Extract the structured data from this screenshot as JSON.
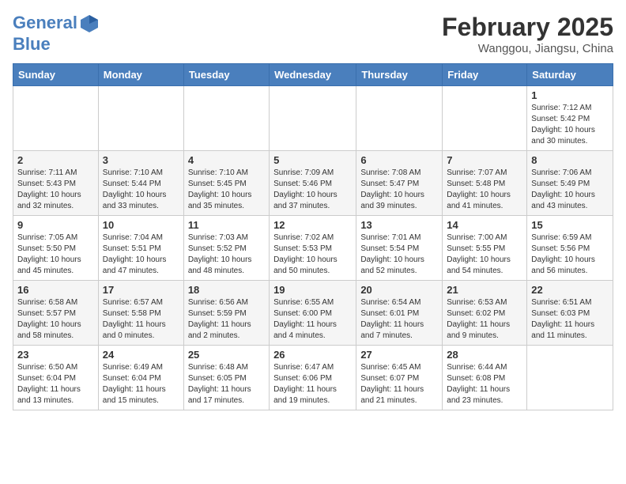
{
  "header": {
    "logo_line1": "General",
    "logo_line2": "Blue",
    "month_title": "February 2025",
    "location": "Wanggou, Jiangsu, China"
  },
  "days_of_week": [
    "Sunday",
    "Monday",
    "Tuesday",
    "Wednesday",
    "Thursday",
    "Friday",
    "Saturday"
  ],
  "weeks": [
    [
      {
        "day": "",
        "info": ""
      },
      {
        "day": "",
        "info": ""
      },
      {
        "day": "",
        "info": ""
      },
      {
        "day": "",
        "info": ""
      },
      {
        "day": "",
        "info": ""
      },
      {
        "day": "",
        "info": ""
      },
      {
        "day": "1",
        "info": "Sunrise: 7:12 AM\nSunset: 5:42 PM\nDaylight: 10 hours and 30 minutes."
      }
    ],
    [
      {
        "day": "2",
        "info": "Sunrise: 7:11 AM\nSunset: 5:43 PM\nDaylight: 10 hours and 32 minutes."
      },
      {
        "day": "3",
        "info": "Sunrise: 7:10 AM\nSunset: 5:44 PM\nDaylight: 10 hours and 33 minutes."
      },
      {
        "day": "4",
        "info": "Sunrise: 7:10 AM\nSunset: 5:45 PM\nDaylight: 10 hours and 35 minutes."
      },
      {
        "day": "5",
        "info": "Sunrise: 7:09 AM\nSunset: 5:46 PM\nDaylight: 10 hours and 37 minutes."
      },
      {
        "day": "6",
        "info": "Sunrise: 7:08 AM\nSunset: 5:47 PM\nDaylight: 10 hours and 39 minutes."
      },
      {
        "day": "7",
        "info": "Sunrise: 7:07 AM\nSunset: 5:48 PM\nDaylight: 10 hours and 41 minutes."
      },
      {
        "day": "8",
        "info": "Sunrise: 7:06 AM\nSunset: 5:49 PM\nDaylight: 10 hours and 43 minutes."
      }
    ],
    [
      {
        "day": "9",
        "info": "Sunrise: 7:05 AM\nSunset: 5:50 PM\nDaylight: 10 hours and 45 minutes."
      },
      {
        "day": "10",
        "info": "Sunrise: 7:04 AM\nSunset: 5:51 PM\nDaylight: 10 hours and 47 minutes."
      },
      {
        "day": "11",
        "info": "Sunrise: 7:03 AM\nSunset: 5:52 PM\nDaylight: 10 hours and 48 minutes."
      },
      {
        "day": "12",
        "info": "Sunrise: 7:02 AM\nSunset: 5:53 PM\nDaylight: 10 hours and 50 minutes."
      },
      {
        "day": "13",
        "info": "Sunrise: 7:01 AM\nSunset: 5:54 PM\nDaylight: 10 hours and 52 minutes."
      },
      {
        "day": "14",
        "info": "Sunrise: 7:00 AM\nSunset: 5:55 PM\nDaylight: 10 hours and 54 minutes."
      },
      {
        "day": "15",
        "info": "Sunrise: 6:59 AM\nSunset: 5:56 PM\nDaylight: 10 hours and 56 minutes."
      }
    ],
    [
      {
        "day": "16",
        "info": "Sunrise: 6:58 AM\nSunset: 5:57 PM\nDaylight: 10 hours and 58 minutes."
      },
      {
        "day": "17",
        "info": "Sunrise: 6:57 AM\nSunset: 5:58 PM\nDaylight: 11 hours and 0 minutes."
      },
      {
        "day": "18",
        "info": "Sunrise: 6:56 AM\nSunset: 5:59 PM\nDaylight: 11 hours and 2 minutes."
      },
      {
        "day": "19",
        "info": "Sunrise: 6:55 AM\nSunset: 6:00 PM\nDaylight: 11 hours and 4 minutes."
      },
      {
        "day": "20",
        "info": "Sunrise: 6:54 AM\nSunset: 6:01 PM\nDaylight: 11 hours and 7 minutes."
      },
      {
        "day": "21",
        "info": "Sunrise: 6:53 AM\nSunset: 6:02 PM\nDaylight: 11 hours and 9 minutes."
      },
      {
        "day": "22",
        "info": "Sunrise: 6:51 AM\nSunset: 6:03 PM\nDaylight: 11 hours and 11 minutes."
      }
    ],
    [
      {
        "day": "23",
        "info": "Sunrise: 6:50 AM\nSunset: 6:04 PM\nDaylight: 11 hours and 13 minutes."
      },
      {
        "day": "24",
        "info": "Sunrise: 6:49 AM\nSunset: 6:04 PM\nDaylight: 11 hours and 15 minutes."
      },
      {
        "day": "25",
        "info": "Sunrise: 6:48 AM\nSunset: 6:05 PM\nDaylight: 11 hours and 17 minutes."
      },
      {
        "day": "26",
        "info": "Sunrise: 6:47 AM\nSunset: 6:06 PM\nDaylight: 11 hours and 19 minutes."
      },
      {
        "day": "27",
        "info": "Sunrise: 6:45 AM\nSunset: 6:07 PM\nDaylight: 11 hours and 21 minutes."
      },
      {
        "day": "28",
        "info": "Sunrise: 6:44 AM\nSunset: 6:08 PM\nDaylight: 11 hours and 23 minutes."
      },
      {
        "day": "",
        "info": ""
      }
    ]
  ]
}
